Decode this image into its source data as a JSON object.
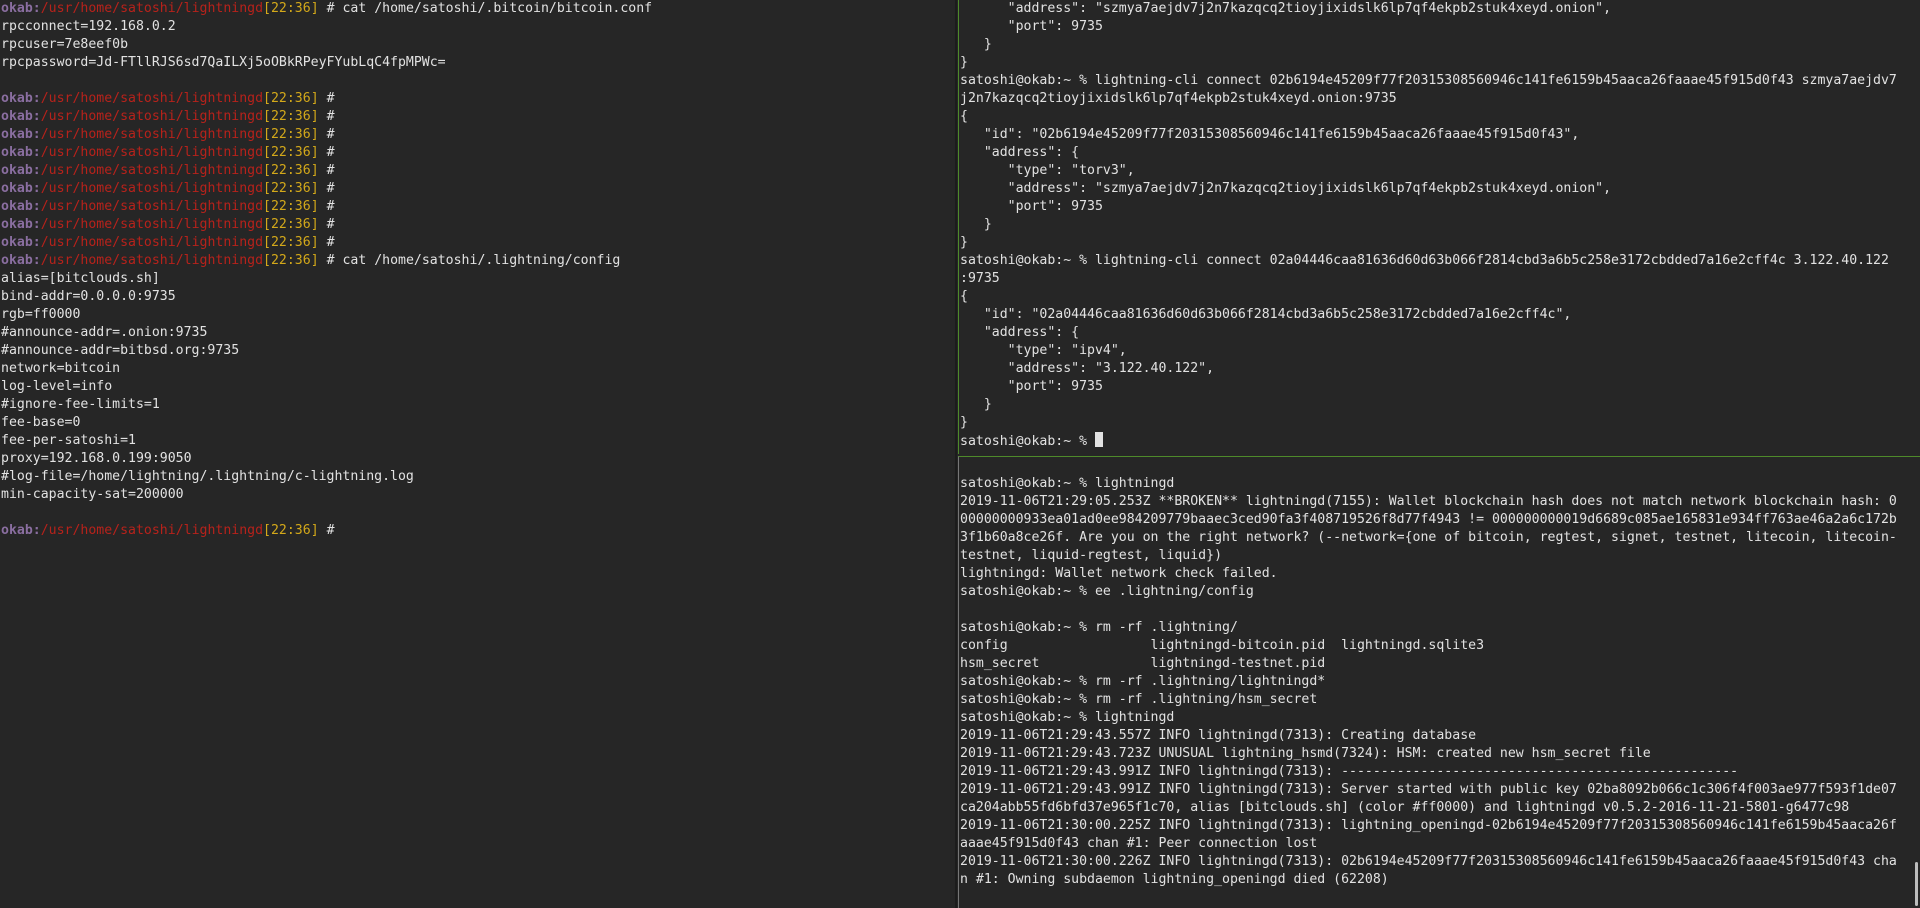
{
  "left_pane": {
    "prompt": {
      "host": "okab",
      "path": "/usr/home/satoshi/lightningd",
      "time": "22:36"
    },
    "lines": [
      {
        "type": "prompt",
        "command": "cat /home/satoshi/.bitcoin/bitcoin.conf"
      },
      {
        "type": "out",
        "text": "rpcconnect=192.168.0.2"
      },
      {
        "type": "out",
        "text": "rpcuser=7e8eef0b"
      },
      {
        "type": "out",
        "text": "rpcpassword=Jd-FTllRJS6sd7QaILXj5oOBkRPeyFYubLqC4fpMPWc="
      },
      {
        "type": "out",
        "text": ""
      },
      {
        "type": "prompt",
        "command": ""
      },
      {
        "type": "prompt",
        "command": ""
      },
      {
        "type": "prompt",
        "command": ""
      },
      {
        "type": "prompt",
        "command": ""
      },
      {
        "type": "prompt",
        "command": ""
      },
      {
        "type": "prompt",
        "command": ""
      },
      {
        "type": "prompt",
        "command": ""
      },
      {
        "type": "prompt",
        "command": ""
      },
      {
        "type": "prompt",
        "command": ""
      },
      {
        "type": "prompt",
        "command": "cat /home/satoshi/.lightning/config"
      },
      {
        "type": "out",
        "text": "alias=[bitclouds.sh]"
      },
      {
        "type": "out",
        "text": "bind-addr=0.0.0.0:9735"
      },
      {
        "type": "out",
        "text": "rgb=ff0000"
      },
      {
        "type": "out",
        "text": "#announce-addr=.onion:9735"
      },
      {
        "type": "out",
        "text": "#announce-addr=bitbsd.org:9735"
      },
      {
        "type": "out",
        "text": "network=bitcoin"
      },
      {
        "type": "out",
        "text": "log-level=info"
      },
      {
        "type": "out",
        "text": "#ignore-fee-limits=1"
      },
      {
        "type": "out",
        "text": "fee-base=0"
      },
      {
        "type": "out",
        "text": "fee-per-satoshi=1"
      },
      {
        "type": "out",
        "text": "proxy=192.168.0.199:9050"
      },
      {
        "type": "out",
        "text": "#log-file=/home/lightning/.lightning/c-lightning.log"
      },
      {
        "type": "out",
        "text": "min-capacity-sat=200000"
      },
      {
        "type": "out",
        "text": ""
      },
      {
        "type": "prompt",
        "command": ""
      }
    ]
  },
  "top_right_pane": {
    "lines": [
      "      \"address\": \"szmya7aejdv7j2n7kazqcq2tioyjixidslk6lp7qf4ekpb2stuk4xeyd.onion\",",
      "      \"port\": 9735",
      "   }",
      "}",
      "satoshi@okab:~ % lightning-cli connect 02b6194e45209f77f20315308560946c141fe6159b45aaca26faaae45f915d0f43 szmya7aejdv7",
      "j2n7kazqcq2tioyjixidslk6lp7qf4ekpb2stuk4xeyd.onion:9735",
      "{",
      "   \"id\": \"02b6194e45209f77f20315308560946c141fe6159b45aaca26faaae45f915d0f43\",",
      "   \"address\": {",
      "      \"type\": \"torv3\",",
      "      \"address\": \"szmya7aejdv7j2n7kazqcq2tioyjixidslk6lp7qf4ekpb2stuk4xeyd.onion\",",
      "      \"port\": 9735",
      "   }",
      "}",
      "satoshi@okab:~ % lightning-cli connect 02a04446caa81636d60d63b066f2814cbd3a6b5c258e3172cbdded7a16e2cff4c 3.122.40.122",
      ":9735",
      "{",
      "   \"id\": \"02a04446caa81636d60d63b066f2814cbd3a6b5c258e3172cbdded7a16e2cff4c\",",
      "   \"address\": {",
      "      \"type\": \"ipv4\",",
      "      \"address\": \"3.122.40.122\",",
      "      \"port\": 9735",
      "   }",
      "}"
    ],
    "final_prompt": "satoshi@okab:~ % "
  },
  "bottom_right_pane": {
    "lines": [
      "",
      "satoshi@okab:~ % lightningd",
      "2019-11-06T21:29:05.253Z **BROKEN** lightningd(7155): Wallet blockchain hash does not match network blockchain hash: 0",
      "00000000933ea01ad0ee984209779baaec3ced90fa3f408719526f8d77f4943 != 000000000019d6689c085ae165831e934ff763ae46a2a6c172b",
      "3f1b60a8ce26f. Are you on the right network? (--network={one of bitcoin, regtest, signet, testnet, litecoin, litecoin-",
      "testnet, liquid-regtest, liquid})",
      "lightningd: Wallet network check failed.",
      "satoshi@okab:~ % ee .lightning/config",
      "",
      "satoshi@okab:~ % rm -rf .lightning/",
      "config                  lightningd-bitcoin.pid  lightningd.sqlite3",
      "hsm_secret              lightningd-testnet.pid",
      "satoshi@okab:~ % rm -rf .lightning/lightningd*",
      "satoshi@okab:~ % rm -rf .lightning/hsm_secret",
      "satoshi@okab:~ % lightningd",
      "2019-11-06T21:29:43.557Z INFO lightningd(7313): Creating database",
      "2019-11-06T21:29:43.723Z UNUSUAL lightning_hsmd(7324): HSM: created new hsm_secret file",
      "2019-11-06T21:29:43.991Z INFO lightningd(7313): --------------------------------------------------",
      "2019-11-06T21:29:43.991Z INFO lightningd(7313): Server started with public key 02ba8092b066c1c306f4f003ae977f593f1de07",
      "ca204abb55fd6bfd37e965f1c70, alias [bitclouds.sh] (color #ff0000) and lightningd v0.5.2-2016-11-21-5801-g6477c98",
      "2019-11-06T21:30:00.225Z INFO lightningd(7313): lightning_openingd-02b6194e45209f77f20315308560946c141fe6159b45aaca26f",
      "aaae45f915d0f43 chan #1: Peer connection lost",
      "2019-11-06T21:30:00.226Z INFO lightningd(7313): 02b6194e45209f77f20315308560946c141fe6159b45aaca26faaae45f915d0f43 cha",
      "n #1: Owning subdaemon lightning_openingd died (62208)"
    ]
  },
  "colors": {
    "background": "#262626",
    "foreground": "#e2e2e2",
    "prompt_host": "#8a6ea0",
    "prompt_path": "#b7221b",
    "prompt_time": "#d4a91a",
    "active_border": "#4e8a2a"
  }
}
